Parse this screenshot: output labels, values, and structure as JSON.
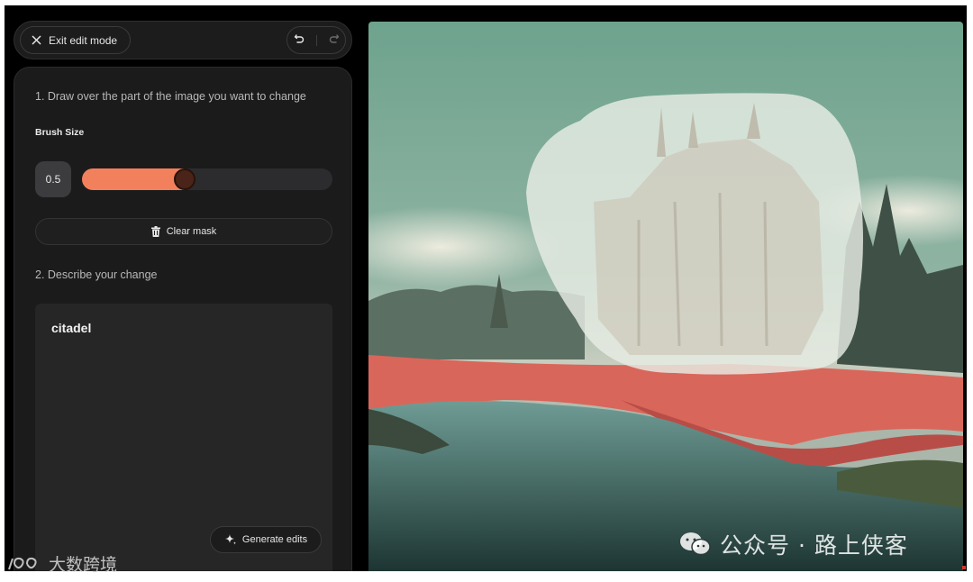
{
  "toolbar": {
    "exit_label": "Exit edit mode",
    "undo_icon": "undo-icon",
    "redo_icon": "redo-icon"
  },
  "panel": {
    "step1": "1. Draw over the part of the image you want to change",
    "brush_label": "Brush Size",
    "brush_value": "0.5",
    "brush_fraction": 0.41,
    "clear_label": "Clear mask",
    "step2": "2. Describe your change",
    "prompt": "citadel",
    "generate_label": "Generate edits"
  },
  "watermarks": {
    "right": "公众号 · 路上侠客",
    "left": "大数跨境"
  },
  "colors": {
    "accent": "#f3805c",
    "background": "#000000",
    "panel": "#1b1b1c"
  }
}
